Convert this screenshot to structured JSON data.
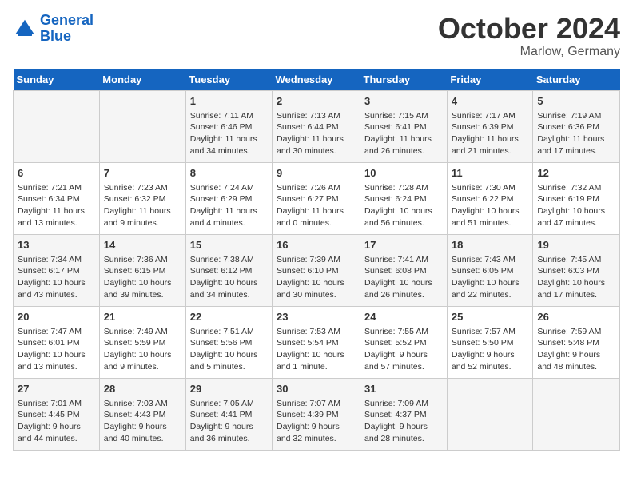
{
  "logo": {
    "line1": "General",
    "line2": "Blue"
  },
  "title": "October 2024",
  "location": "Marlow, Germany",
  "days_header": [
    "Sunday",
    "Monday",
    "Tuesday",
    "Wednesday",
    "Thursday",
    "Friday",
    "Saturday"
  ],
  "weeks": [
    [
      {
        "day": "",
        "sunrise": "",
        "sunset": "",
        "daylight": ""
      },
      {
        "day": "",
        "sunrise": "",
        "sunset": "",
        "daylight": ""
      },
      {
        "day": "1",
        "sunrise": "Sunrise: 7:11 AM",
        "sunset": "Sunset: 6:46 PM",
        "daylight": "Daylight: 11 hours and 34 minutes."
      },
      {
        "day": "2",
        "sunrise": "Sunrise: 7:13 AM",
        "sunset": "Sunset: 6:44 PM",
        "daylight": "Daylight: 11 hours and 30 minutes."
      },
      {
        "day": "3",
        "sunrise": "Sunrise: 7:15 AM",
        "sunset": "Sunset: 6:41 PM",
        "daylight": "Daylight: 11 hours and 26 minutes."
      },
      {
        "day": "4",
        "sunrise": "Sunrise: 7:17 AM",
        "sunset": "Sunset: 6:39 PM",
        "daylight": "Daylight: 11 hours and 21 minutes."
      },
      {
        "day": "5",
        "sunrise": "Sunrise: 7:19 AM",
        "sunset": "Sunset: 6:36 PM",
        "daylight": "Daylight: 11 hours and 17 minutes."
      }
    ],
    [
      {
        "day": "6",
        "sunrise": "Sunrise: 7:21 AM",
        "sunset": "Sunset: 6:34 PM",
        "daylight": "Daylight: 11 hours and 13 minutes."
      },
      {
        "day": "7",
        "sunrise": "Sunrise: 7:23 AM",
        "sunset": "Sunset: 6:32 PM",
        "daylight": "Daylight: 11 hours and 9 minutes."
      },
      {
        "day": "8",
        "sunrise": "Sunrise: 7:24 AM",
        "sunset": "Sunset: 6:29 PM",
        "daylight": "Daylight: 11 hours and 4 minutes."
      },
      {
        "day": "9",
        "sunrise": "Sunrise: 7:26 AM",
        "sunset": "Sunset: 6:27 PM",
        "daylight": "Daylight: 11 hours and 0 minutes."
      },
      {
        "day": "10",
        "sunrise": "Sunrise: 7:28 AM",
        "sunset": "Sunset: 6:24 PM",
        "daylight": "Daylight: 10 hours and 56 minutes."
      },
      {
        "day": "11",
        "sunrise": "Sunrise: 7:30 AM",
        "sunset": "Sunset: 6:22 PM",
        "daylight": "Daylight: 10 hours and 51 minutes."
      },
      {
        "day": "12",
        "sunrise": "Sunrise: 7:32 AM",
        "sunset": "Sunset: 6:19 PM",
        "daylight": "Daylight: 10 hours and 47 minutes."
      }
    ],
    [
      {
        "day": "13",
        "sunrise": "Sunrise: 7:34 AM",
        "sunset": "Sunset: 6:17 PM",
        "daylight": "Daylight: 10 hours and 43 minutes."
      },
      {
        "day": "14",
        "sunrise": "Sunrise: 7:36 AM",
        "sunset": "Sunset: 6:15 PM",
        "daylight": "Daylight: 10 hours and 39 minutes."
      },
      {
        "day": "15",
        "sunrise": "Sunrise: 7:38 AM",
        "sunset": "Sunset: 6:12 PM",
        "daylight": "Daylight: 10 hours and 34 minutes."
      },
      {
        "day": "16",
        "sunrise": "Sunrise: 7:39 AM",
        "sunset": "Sunset: 6:10 PM",
        "daylight": "Daylight: 10 hours and 30 minutes."
      },
      {
        "day": "17",
        "sunrise": "Sunrise: 7:41 AM",
        "sunset": "Sunset: 6:08 PM",
        "daylight": "Daylight: 10 hours and 26 minutes."
      },
      {
        "day": "18",
        "sunrise": "Sunrise: 7:43 AM",
        "sunset": "Sunset: 6:05 PM",
        "daylight": "Daylight: 10 hours and 22 minutes."
      },
      {
        "day": "19",
        "sunrise": "Sunrise: 7:45 AM",
        "sunset": "Sunset: 6:03 PM",
        "daylight": "Daylight: 10 hours and 17 minutes."
      }
    ],
    [
      {
        "day": "20",
        "sunrise": "Sunrise: 7:47 AM",
        "sunset": "Sunset: 6:01 PM",
        "daylight": "Daylight: 10 hours and 13 minutes."
      },
      {
        "day": "21",
        "sunrise": "Sunrise: 7:49 AM",
        "sunset": "Sunset: 5:59 PM",
        "daylight": "Daylight: 10 hours and 9 minutes."
      },
      {
        "day": "22",
        "sunrise": "Sunrise: 7:51 AM",
        "sunset": "Sunset: 5:56 PM",
        "daylight": "Daylight: 10 hours and 5 minutes."
      },
      {
        "day": "23",
        "sunrise": "Sunrise: 7:53 AM",
        "sunset": "Sunset: 5:54 PM",
        "daylight": "Daylight: 10 hours and 1 minute."
      },
      {
        "day": "24",
        "sunrise": "Sunrise: 7:55 AM",
        "sunset": "Sunset: 5:52 PM",
        "daylight": "Daylight: 9 hours and 57 minutes."
      },
      {
        "day": "25",
        "sunrise": "Sunrise: 7:57 AM",
        "sunset": "Sunset: 5:50 PM",
        "daylight": "Daylight: 9 hours and 52 minutes."
      },
      {
        "day": "26",
        "sunrise": "Sunrise: 7:59 AM",
        "sunset": "Sunset: 5:48 PM",
        "daylight": "Daylight: 9 hours and 48 minutes."
      }
    ],
    [
      {
        "day": "27",
        "sunrise": "Sunrise: 7:01 AM",
        "sunset": "Sunset: 4:45 PM",
        "daylight": "Daylight: 9 hours and 44 minutes."
      },
      {
        "day": "28",
        "sunrise": "Sunrise: 7:03 AM",
        "sunset": "Sunset: 4:43 PM",
        "daylight": "Daylight: 9 hours and 40 minutes."
      },
      {
        "day": "29",
        "sunrise": "Sunrise: 7:05 AM",
        "sunset": "Sunset: 4:41 PM",
        "daylight": "Daylight: 9 hours and 36 minutes."
      },
      {
        "day": "30",
        "sunrise": "Sunrise: 7:07 AM",
        "sunset": "Sunset: 4:39 PM",
        "daylight": "Daylight: 9 hours and 32 minutes."
      },
      {
        "day": "31",
        "sunrise": "Sunrise: 7:09 AM",
        "sunset": "Sunset: 4:37 PM",
        "daylight": "Daylight: 9 hours and 28 minutes."
      },
      {
        "day": "",
        "sunrise": "",
        "sunset": "",
        "daylight": ""
      },
      {
        "day": "",
        "sunrise": "",
        "sunset": "",
        "daylight": ""
      }
    ]
  ]
}
